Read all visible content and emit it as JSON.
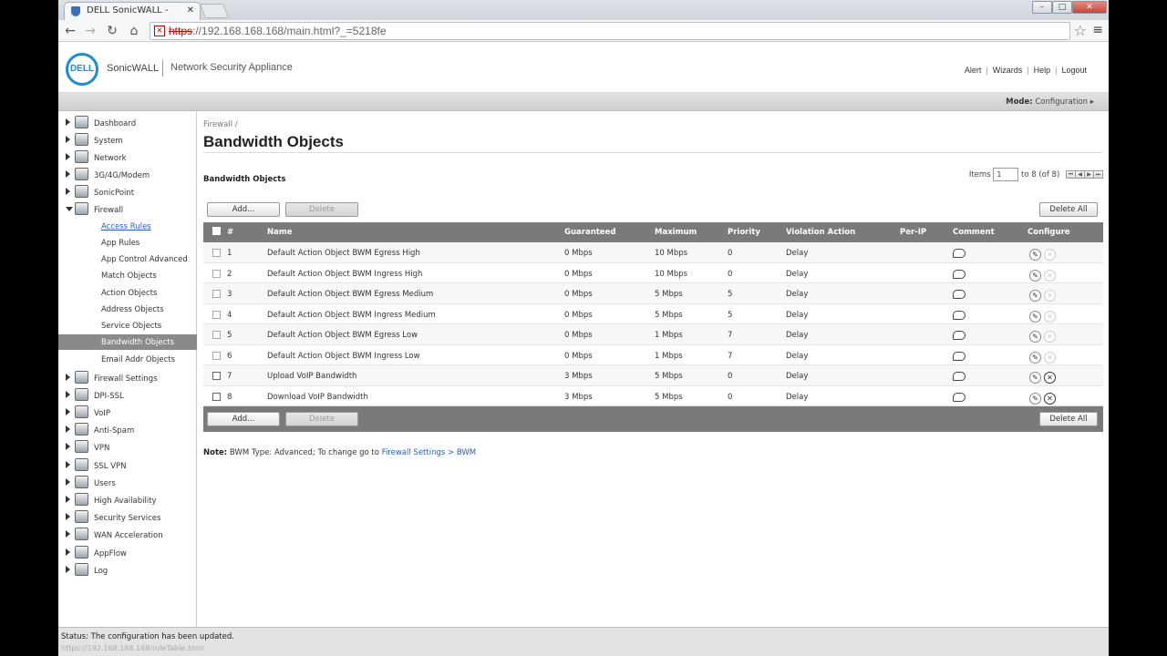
{
  "browser": {
    "tab_title": "DELL SonicWALL - Admin",
    "url_scheme": "https",
    "url_rest": "://192.168.168.168/main.html?_=5218fe",
    "hover_url": "https://192.168.168.168/ruleTable.html"
  },
  "header": {
    "logo_text": "DELL",
    "brand": "SonicWALL",
    "product": "Network Security Appliance",
    "links": [
      "Alert",
      "Wizards",
      "Help",
      "Logout"
    ]
  },
  "modebar": {
    "label": "Mode:",
    "value": "Configuration ▸"
  },
  "sidebar": {
    "items": [
      {
        "label": "Dashboard"
      },
      {
        "label": "System"
      },
      {
        "label": "Network"
      },
      {
        "label": "3G/4G/Modem"
      },
      {
        "label": "SonicPoint"
      },
      {
        "label": "Firewall"
      },
      {
        "label": "Firewall Settings"
      },
      {
        "label": "DPI-SSL"
      },
      {
        "label": "VoIP"
      },
      {
        "label": "Anti-Spam"
      },
      {
        "label": "VPN"
      },
      {
        "label": "SSL VPN"
      },
      {
        "label": "Users"
      },
      {
        "label": "High Availability"
      },
      {
        "label": "Security Services"
      },
      {
        "label": "WAN Acceleration"
      },
      {
        "label": "AppFlow"
      },
      {
        "label": "Log"
      }
    ],
    "firewall_sub": [
      {
        "label": "Access Rules"
      },
      {
        "label": "App Rules"
      },
      {
        "label": "App Control Advanced"
      },
      {
        "label": "Match Objects"
      },
      {
        "label": "Action Objects"
      },
      {
        "label": "Address Objects"
      },
      {
        "label": "Service Objects"
      },
      {
        "label": "Bandwidth Objects"
      },
      {
        "label": "Email Addr Objects"
      }
    ]
  },
  "main": {
    "breadcrumb": "Firewall /",
    "title": "Bandwidth Objects",
    "section_title": "Bandwidth Objects",
    "pager": {
      "items_label": "Items",
      "items_value": "1",
      "range": "to 8 (of 8)"
    },
    "buttons": {
      "add": "Add...",
      "delete": "Delete",
      "delete_all": "Delete All"
    },
    "columns": [
      "#",
      "Name",
      "Guaranteed",
      "Maximum",
      "Priority",
      "Violation Action",
      "Per-IP",
      "Comment",
      "Configure"
    ],
    "rows": [
      {
        "num": "1",
        "name": "Default Action Object BWM Egress High",
        "guaranteed": "0 Mbps",
        "maximum": "10 Mbps",
        "priority": "0",
        "violation": "Delay",
        "deletable": false
      },
      {
        "num": "2",
        "name": "Default Action Object BWM Ingress High",
        "guaranteed": "0 Mbps",
        "maximum": "10 Mbps",
        "priority": "0",
        "violation": "Delay",
        "deletable": false
      },
      {
        "num": "3",
        "name": "Default Action Object BWM Egress Medium",
        "guaranteed": "0 Mbps",
        "maximum": "5 Mbps",
        "priority": "5",
        "violation": "Delay",
        "deletable": false
      },
      {
        "num": "4",
        "name": "Default Action Object BWM Ingress Medium",
        "guaranteed": "0 Mbps",
        "maximum": "5 Mbps",
        "priority": "5",
        "violation": "Delay",
        "deletable": false
      },
      {
        "num": "5",
        "name": "Default Action Object BWM Egress Low",
        "guaranteed": "0 Mbps",
        "maximum": "1 Mbps",
        "priority": "7",
        "violation": "Delay",
        "deletable": false
      },
      {
        "num": "6",
        "name": "Default Action Object BWM Ingress Low",
        "guaranteed": "0 Mbps",
        "maximum": "1 Mbps",
        "priority": "7",
        "violation": "Delay",
        "deletable": false
      },
      {
        "num": "7",
        "name": "Upload VoIP Bandwidth",
        "guaranteed": "3 Mbps",
        "maximum": "5 Mbps",
        "priority": "0",
        "violation": "Delay",
        "deletable": true
      },
      {
        "num": "8",
        "name": "Download VoIP Bandwidth",
        "guaranteed": "3 Mbps",
        "maximum": "5 Mbps",
        "priority": "0",
        "violation": "Delay",
        "deletable": true
      }
    ],
    "note": {
      "label": "Note:",
      "text": "BWM Type: Advanced; To change go to",
      "link": "Firewall Settings > BWM"
    }
  },
  "status": {
    "text": "Status: The configuration has been updated."
  }
}
